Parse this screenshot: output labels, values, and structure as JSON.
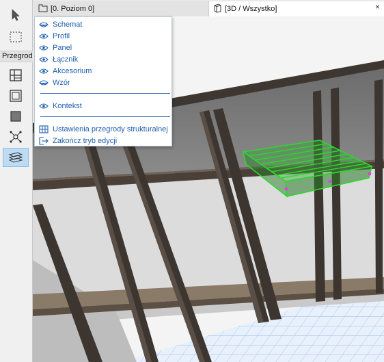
{
  "toolbox": {
    "label": "Przegrod",
    "tools": [
      {
        "name": "arrow-select-icon"
      },
      {
        "name": "marquee-icon"
      },
      {
        "name": "grid-layout-icon"
      },
      {
        "name": "frame-icon"
      },
      {
        "name": "solid-panel-icon"
      },
      {
        "name": "connector-node-icon"
      },
      {
        "name": "stair-accessory-icon",
        "active": true
      }
    ]
  },
  "tabs": {
    "plan_label": "[0. Poziom 0]",
    "view3d_label": "[3D / Wszystko]",
    "close_glyph": "×"
  },
  "menu": {
    "items": [
      {
        "label": "Schemat",
        "icon": "eye-closed-icon"
      },
      {
        "label": "Profil",
        "icon": "eye-icon"
      },
      {
        "label": "Panel",
        "icon": "eye-icon"
      },
      {
        "label": "Łącznik",
        "icon": "eye-icon"
      },
      {
        "label": "Akcesorium",
        "icon": "eye-icon"
      },
      {
        "label": "Wzór",
        "icon": "eye-closed-icon"
      }
    ],
    "context_item": {
      "label": "Kontekst",
      "icon": "eye-icon"
    },
    "actions": [
      {
        "label": "Ustawienia przegrody strukturalnej",
        "icon": "grid-settings-icon"
      },
      {
        "label": "Zakończ tryb edycji",
        "icon": "exit-icon"
      }
    ]
  },
  "colors": {
    "menu_text": "#1f5fae",
    "selection_green": "#2cd82c",
    "beam": "#4a4038",
    "active_tool": "#bcdcf4"
  }
}
